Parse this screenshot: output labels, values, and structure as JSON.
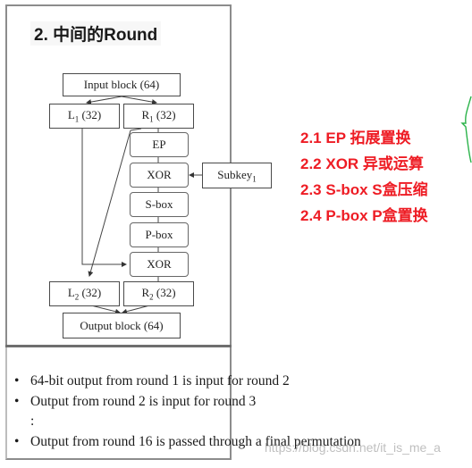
{
  "slide": {
    "title": "2. 中间的Round"
  },
  "diagram": {
    "input_block": "Input block (64)",
    "l1": {
      "base": "L",
      "sub": "1",
      "bits": " (32)"
    },
    "r1": {
      "base": "R",
      "sub": "1",
      "bits": " (32)"
    },
    "ep": "EP",
    "xor1": "XOR",
    "subkey": {
      "base": "Subkey",
      "sub": "1"
    },
    "sbox": "S-box",
    "pbox": "P-box",
    "xor2": "XOR",
    "l2": {
      "base": "L",
      "sub": "2",
      "bits": " (32)"
    },
    "r2": {
      "base": "R",
      "sub": "2",
      "bits": " (32)"
    },
    "output_block": "Output block (64)"
  },
  "steps": [
    "2.1 EP 拓展置换",
    "2.2 XOR 异或运算",
    "2.3 S-box S盒压缩",
    "2.4 P-box P盒置换"
  ],
  "notes": {
    "bullet": "•",
    "items": [
      "64-bit output from round 1 is input for round 2",
      "Output from round 2 is input for round 3",
      ":",
      "Output from round 16 is passed through a final permutation"
    ]
  },
  "watermark": "https://blog.csdn.net/it_is_me_a",
  "colors": {
    "step_text": "#ee1c24",
    "annotation_stroke": "#2bb34a",
    "frame": "#8c8c8c"
  }
}
